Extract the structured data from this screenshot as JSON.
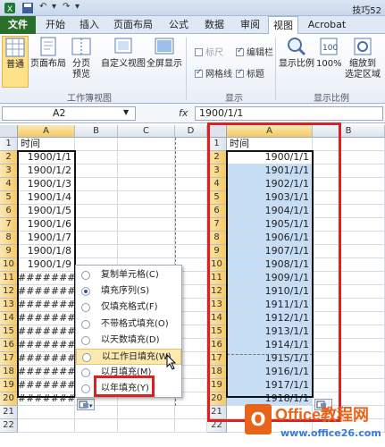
{
  "title": "技巧52",
  "quick_access": {
    "undo": "↶",
    "redo": "↷",
    "more": "▾"
  },
  "tabs": [
    "文件",
    "开始",
    "插入",
    "页面布局",
    "公式",
    "数据",
    "审阅",
    "视图",
    "Acrobat"
  ],
  "ribbon": {
    "workbook_views": {
      "normal": "普通",
      "page_layout": "页面布局",
      "page_break_1": "分页",
      "page_break_2": "预览",
      "custom": "自定义视图",
      "fullscreen": "全屏显示",
      "label": "工作簿视图"
    },
    "show": {
      "ruler": "标尺",
      "gridlines": "网格线",
      "formula_bar": "编辑栏",
      "headings": "标题",
      "label": "显示"
    },
    "zoom": {
      "zoom": "显示比例",
      "hundred": "100%",
      "selection_1": "缩放到",
      "selection_2": "选定区域",
      "label": "显示比例"
    }
  },
  "formula_bar": {
    "name_box": "A2",
    "fx": "fx",
    "content": "1900/1/1"
  },
  "left_sheet": {
    "columns": [
      "A",
      "B",
      "C",
      "D"
    ],
    "rows": [
      "1",
      "2",
      "3",
      "4",
      "5",
      "6",
      "7",
      "8",
      "9",
      "10",
      "11",
      "12",
      "13",
      "14",
      "15",
      "16",
      "17",
      "18",
      "19",
      "20",
      "21",
      "22"
    ],
    "header_cell": "时间",
    "values": [
      "1900/1/1",
      "1900/1/2",
      "1900/1/3",
      "1900/1/4",
      "1900/1/5",
      "1900/1/6",
      "1900/1/7",
      "1900/1/8",
      "1900/1/9",
      "########",
      "########",
      "########",
      "########",
      "########",
      "########",
      "########",
      "########",
      "########",
      "########"
    ]
  },
  "right_sheet": {
    "columns": [
      "A",
      "B"
    ],
    "rows": [
      "1",
      "2",
      "3",
      "4",
      "5",
      "6",
      "7",
      "8",
      "9",
      "10",
      "11",
      "12",
      "13",
      "14",
      "15",
      "16",
      "17",
      "18",
      "19",
      "20",
      "21",
      "22"
    ],
    "header_cell": "时间",
    "values": [
      "1900/1/1",
      "1901/1/1",
      "1902/1/1",
      "1903/1/1",
      "1904/1/1",
      "1905/1/1",
      "1906/1/1",
      "1907/1/1",
      "1908/1/1",
      "1909/1/1",
      "1910/1/1",
      "1911/1/1",
      "1912/1/1",
      "1913/1/1",
      "1914/1/1",
      "1915/1/1",
      "1916/1/1",
      "1917/1/1",
      "1918/1/1"
    ]
  },
  "autofill_menu": {
    "items": [
      "复制单元格(C)",
      "填充序列(S)",
      "仅填充格式(F)",
      "不带格式填充(O)",
      "以天数填充(D)",
      "以工作日填充(W)",
      "以月填充(M)",
      "以年填充(Y)"
    ],
    "selected_index": 1,
    "hover_index": 5
  },
  "watermark": {
    "logo": "O",
    "line1": "Office教程网",
    "line2": "www.office26.com"
  },
  "colors": {
    "selection_fill": "#c6ddf6",
    "header_sel": "#f6c961",
    "red_box": "#e02020",
    "file_tab": "#2a6f2b"
  }
}
